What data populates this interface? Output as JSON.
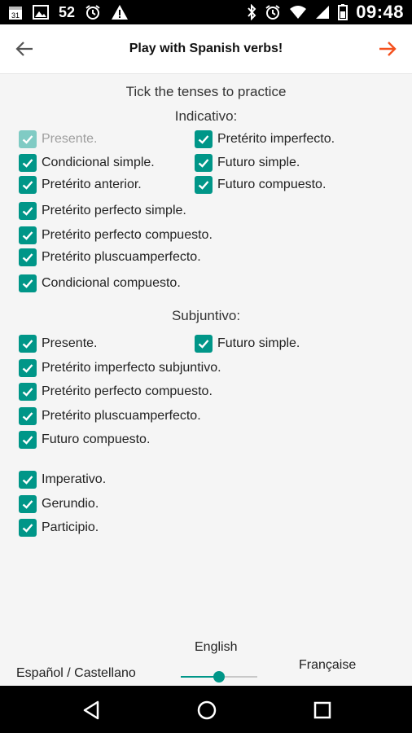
{
  "status_bar": {
    "notification_count": "52",
    "time": "09:48",
    "left_icons": [
      "calendar-icon",
      "image-icon",
      "alarm-icon",
      "warning-icon"
    ],
    "right_icons": [
      "bluetooth-icon",
      "alarm-icon",
      "wifi-icon",
      "signal-icon",
      "battery-icon"
    ]
  },
  "app_bar": {
    "title": "Play with Spanish verbs!",
    "accent": "#f4511e"
  },
  "main": {
    "instruction": "Tick the tenses to practice",
    "indicativo": {
      "heading": "Indicativo:",
      "items": [
        {
          "label": "Presente.",
          "checked": true,
          "disabled": true
        },
        {
          "label": "Pretérito imperfecto.",
          "checked": true
        },
        {
          "label": "Condicional simple.",
          "checked": true
        },
        {
          "label": "Futuro simple.",
          "checked": true
        },
        {
          "label": "Pretérito anterior.",
          "checked": true
        },
        {
          "label": "Futuro compuesto.",
          "checked": true
        },
        {
          "label": "Pretérito perfecto simple.",
          "checked": true
        },
        {
          "label": "Pretérito perfecto compuesto.",
          "checked": true
        },
        {
          "label": "Pretérito pluscuamperfecto.",
          "checked": true
        },
        {
          "label": "Condicional compuesto.",
          "checked": true
        }
      ]
    },
    "subjuntivo": {
      "heading": "Subjuntivo:",
      "items": [
        {
          "label": "Presente.",
          "checked": true
        },
        {
          "label": "Futuro simple.",
          "checked": true
        },
        {
          "label": "Pretérito imperfecto subjuntivo.",
          "checked": true
        },
        {
          "label": "Pretérito perfecto compuesto.",
          "checked": true
        },
        {
          "label": "Pretérito pluscuamperfecto.",
          "checked": true
        },
        {
          "label": "Futuro compuesto.",
          "checked": true
        }
      ]
    },
    "others": {
      "items": [
        {
          "label": "Imperativo.",
          "checked": true
        },
        {
          "label": "Gerundio.",
          "checked": true
        },
        {
          "label": "Participio.",
          "checked": true
        }
      ]
    }
  },
  "language": {
    "left_label": "Español / Castellano",
    "center_label": "English",
    "right_label": "Française",
    "slider_value": 0.5
  },
  "colors": {
    "checkbox": "#009688",
    "checkbox_disabled": "#80cbc4"
  }
}
